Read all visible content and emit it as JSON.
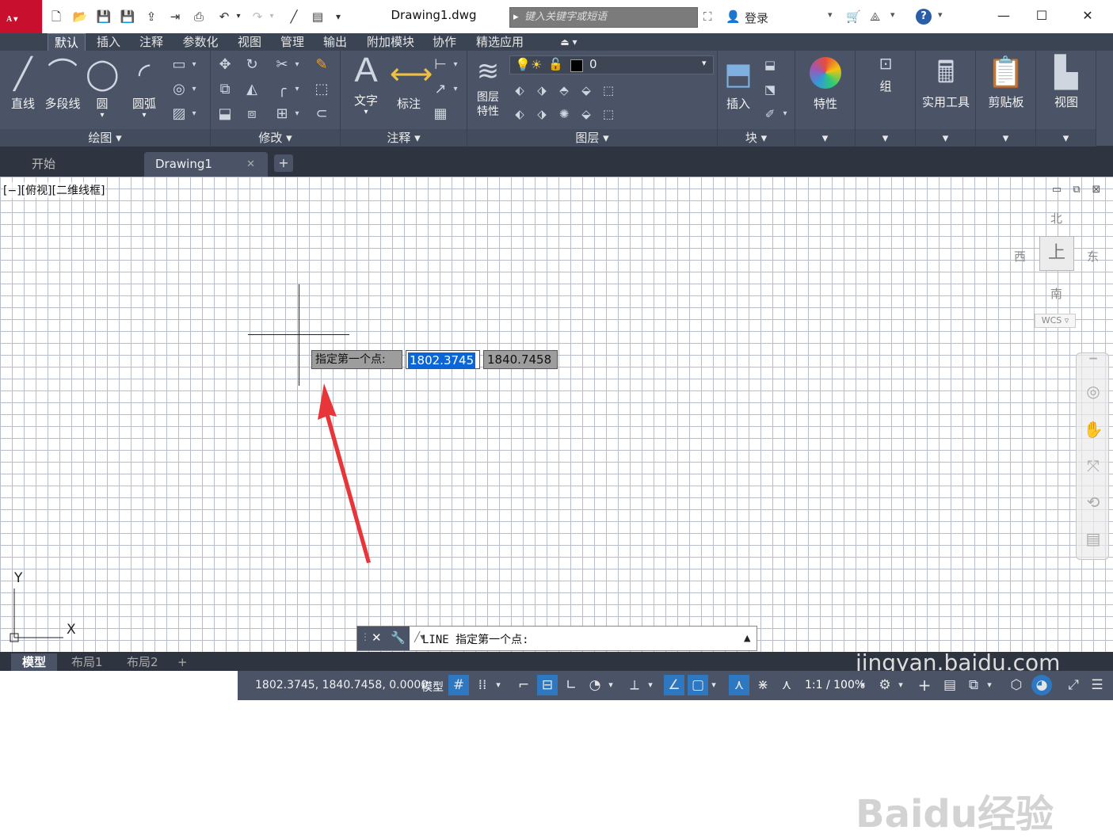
{
  "app": {
    "logo": "A",
    "title": "Drawing1.dwg",
    "search_placeholder": "键入关键字或短语",
    "login": "登录"
  },
  "ribbon_tabs": [
    "默认",
    "插入",
    "注释",
    "参数化",
    "视图",
    "管理",
    "输出",
    "附加模块",
    "协作",
    "精选应用"
  ],
  "ribbon": {
    "draw": {
      "title": "绘图",
      "line": "直线",
      "polyline": "多段线",
      "circle": "圆",
      "arc": "圆弧"
    },
    "modify": {
      "title": "修改"
    },
    "annotation": {
      "title": "注释",
      "text": "文字",
      "dimension": "标注"
    },
    "layers": {
      "title": "图层",
      "layer_props_1": "图层",
      "layer_props_2": "特性",
      "current_layer": "0"
    },
    "block": {
      "title": "块",
      "insert": "插入"
    },
    "properties": "特性",
    "groups": "组",
    "utilities": "实用工具",
    "clipboard": "剪贴板",
    "view": "视图"
  },
  "doc_tabs": [
    {
      "label": "开始"
    },
    {
      "label": "Drawing1"
    }
  ],
  "viewport": {
    "label": "[−][俯视][二维线框]",
    "north": "北",
    "south": "南",
    "east": "东",
    "west": "西",
    "cube_face": "上",
    "wcs": "WCS"
  },
  "ucs": {
    "x": "X",
    "y": "Y"
  },
  "dynamic_input": {
    "prompt": "指定第一个点:",
    "x_value": "1802.3745",
    "y_value": "1840.7458"
  },
  "command_line": {
    "text": "LINE 指定第一个点:"
  },
  "layout_tabs": [
    "模型",
    "布局1",
    "布局2"
  ],
  "status": {
    "coords": "1802.3745, 1840.7458, 0.0000",
    "model": "模型",
    "scale": "1:1 / 100%"
  },
  "watermark": {
    "brand": "Baidu经验",
    "url": "jingyan.baidu.com"
  },
  "colors": {
    "ribbon_bg": "#4a5466",
    "accent": "#c8102e",
    "highlight": "#0a66d6",
    "arrow": "#e8353a"
  }
}
